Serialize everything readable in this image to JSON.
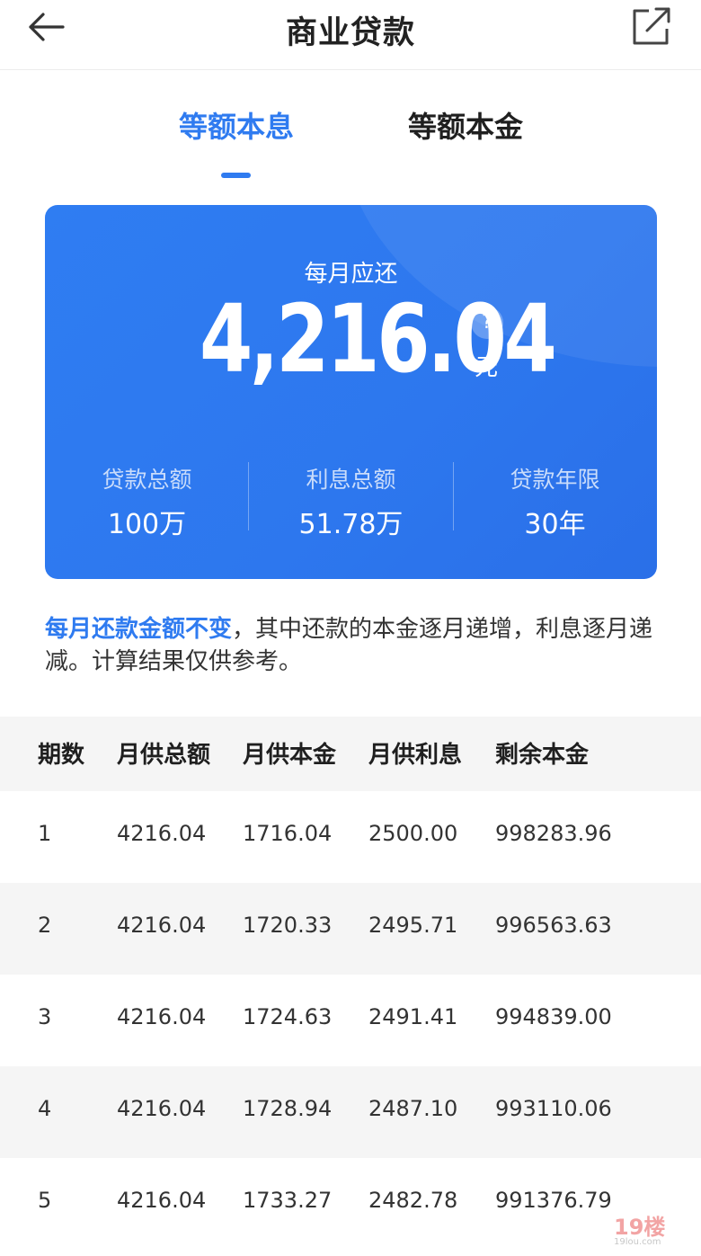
{
  "header": {
    "title": "商业贷款",
    "back_icon": "arrow-left-icon",
    "share_icon": "share-external-icon"
  },
  "tabs": [
    {
      "label": "等额本息",
      "active": true
    },
    {
      "label": "等额本金",
      "active": false
    }
  ],
  "summary": {
    "monthly_label": "每月应还",
    "monthly_amount": "4,216.04",
    "unit": "元",
    "help_symbol": "?",
    "stats": [
      {
        "label": "贷款总额",
        "value": "100万"
      },
      {
        "label": "利息总额",
        "value": "51.78万"
      },
      {
        "label": "贷款年限",
        "value": "30年"
      }
    ]
  },
  "note": {
    "highlight": "每月还款金额不变",
    "text": "，其中还款的本金逐月递增，利息逐月递减。计算结果仅供参考。"
  },
  "table": {
    "headers": [
      "期数",
      "月供总额",
      "月供本金",
      "月供利息",
      "剩余本金"
    ],
    "rows": [
      [
        "1",
        "4216.04",
        "1716.04",
        "2500.00",
        "998283.96"
      ],
      [
        "2",
        "4216.04",
        "1720.33",
        "2495.71",
        "996563.63"
      ],
      [
        "3",
        "4216.04",
        "1724.63",
        "2491.41",
        "994839.00"
      ],
      [
        "4",
        "4216.04",
        "1728.94",
        "2487.10",
        "993110.06"
      ],
      [
        "5",
        "4216.04",
        "1733.27",
        "2482.78",
        "991376.79"
      ]
    ]
  },
  "watermark": {
    "text": "19楼",
    "subtext": "19lou.com"
  },
  "colors": {
    "accent": "#2f7bf0",
    "card": "#2d77ee",
    "row_alt": "#f5f5f5"
  }
}
